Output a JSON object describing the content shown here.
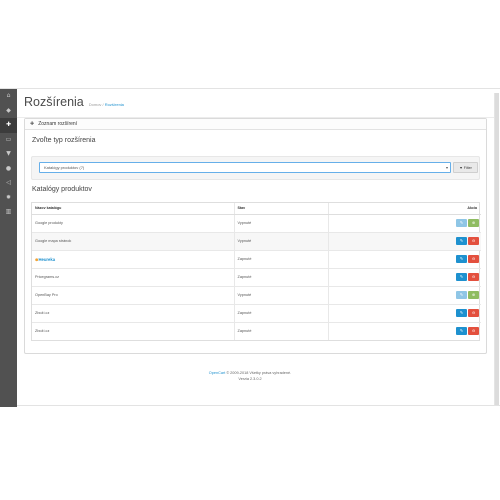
{
  "sidebar": {
    "icons": [
      "dashboard-icon",
      "tag-icon",
      "puzzle-icon",
      "desktop-icon",
      "shopping-cart-icon",
      "user-icon",
      "share-icon",
      "cog-icon",
      "bar-chart-icon"
    ],
    "active_index": 2
  },
  "header": {
    "title": "Rozšírenia",
    "breadcrumb": [
      {
        "label": "Domov"
      },
      {
        "label": "Rozšírenia"
      }
    ]
  },
  "panel": {
    "heading": "Zoznam rozšírení",
    "choose_type_title": "Zvoľte typ rozšírenia",
    "select_value": "Katalógy produktov (7)",
    "filter_label": "Filter",
    "list_title": "Katalógy produktov"
  },
  "table": {
    "columns": [
      "Názov katalógu",
      "Stav",
      "Akcia"
    ],
    "rows": [
      {
        "name": "Google produkty",
        "status": "Vypnuté",
        "logo": false,
        "installed": false
      },
      {
        "name": "Google mapa stránok",
        "status": "Vypnuté",
        "logo": false,
        "installed": true
      },
      {
        "name": "Heureka",
        "status": "Zapnuté",
        "logo": true,
        "installed": true
      },
      {
        "name": "Pricegrams.cz",
        "status": "Zapnuté",
        "logo": false,
        "installed": true
      },
      {
        "name": "OpenBay Pro",
        "status": "Vypnuté",
        "logo": false,
        "installed": false
      },
      {
        "name": "Zboží.cz",
        "status": "Zapnuté",
        "logo": false,
        "installed": true
      },
      {
        "name": "Zboží.cz",
        "status": "Zapnuté",
        "logo": false,
        "installed": true
      }
    ]
  },
  "footer": {
    "brand": "OpenCart",
    "copyright": "© 2009-2018 Všetky práva vyhradené.",
    "version": "Verzia 2.3.0.2"
  },
  "colors": {
    "sidebar": "#515151",
    "accent": "#1e91cf",
    "danger": "#e3503e",
    "success": "#8fbc62"
  }
}
